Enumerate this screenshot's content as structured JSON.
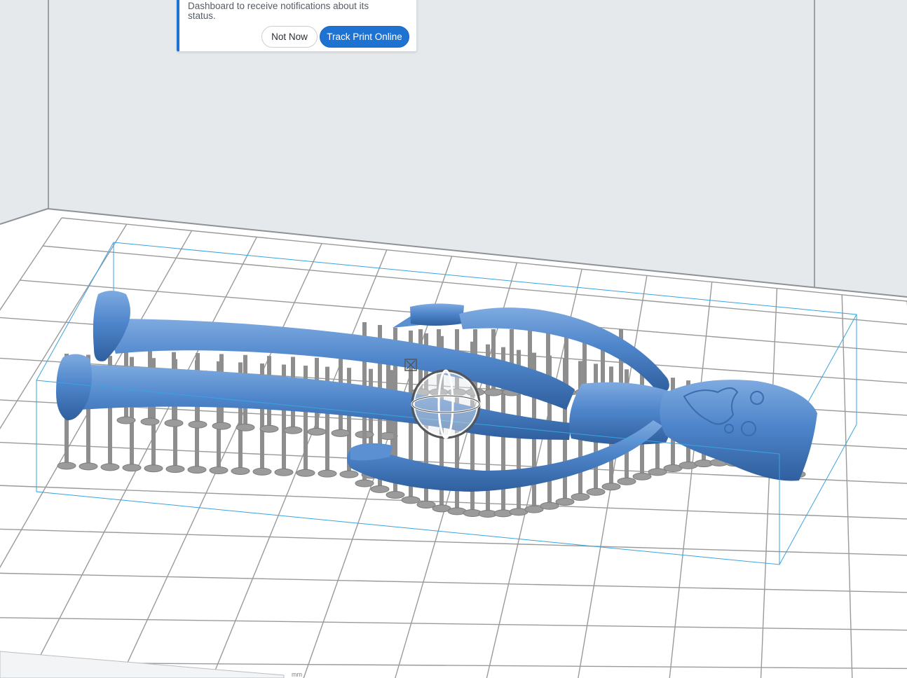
{
  "notification": {
    "message_lines": [
      "Dashboard to receive notifications about its",
      "status."
    ],
    "not_now_label": "Not Now",
    "track_label": "Track Print Online"
  },
  "scene": {
    "model_color": "#4f86cb",
    "support_color": "#8e8e8e",
    "grid_color": "#9a9a9a",
    "bounding_box_color": "#3aa3e0",
    "background_color": "#e6e9ec",
    "accent_color": "#1e73d2",
    "icons": [
      "rotate-gizmo-icon",
      "scale-handle-icon"
    ]
  },
  "corner_label": "mm"
}
